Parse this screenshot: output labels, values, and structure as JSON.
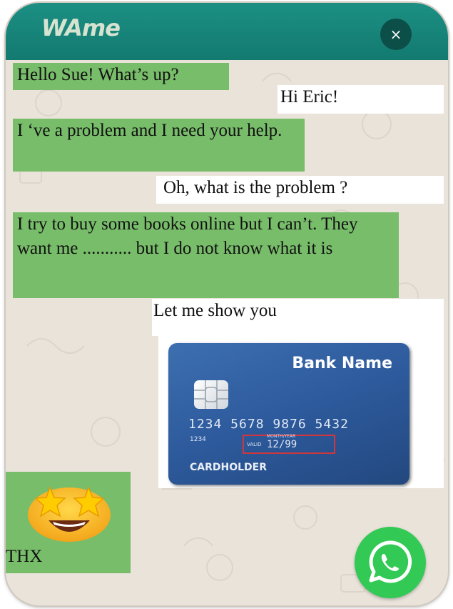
{
  "app": {
    "logo_text": "WAme",
    "close_icon": "×"
  },
  "messages": [
    {
      "sender": "Eric",
      "text": "Hello Sue! What’s up?"
    },
    {
      "sender": "Sue",
      "text": "Hi Eric!"
    },
    {
      "sender": "Eric",
      "text": "I ‘ve a problem and I need your help."
    },
    {
      "sender": "Sue",
      "text": "Oh, what is the problem ?"
    },
    {
      "sender": "Eric",
      "text": "I try to buy some books online but I can’t. They want me ........... but  I do not know what it is"
    },
    {
      "sender": "Sue",
      "text": "Let me show you"
    }
  ],
  "card": {
    "bank_name": "Bank Name",
    "number": "1234  5678  9876  5432",
    "small_number": "1234",
    "valid_label": "VALID",
    "month_year_label": "MONTH/YEAR",
    "expiry": "12/99",
    "holder": "CARDHOLDER"
  },
  "final": {
    "emoji": "star-struck-emoji",
    "text": "THX"
  },
  "colors": {
    "header": "#1a8a7e",
    "outgoing": "#78bd6a",
    "incoming": "#ffffff",
    "whatsapp": "#32c954",
    "close": "#0c4f49"
  },
  "icons": {
    "whatsapp_button": "whatsapp-icon",
    "close": "close-icon"
  }
}
